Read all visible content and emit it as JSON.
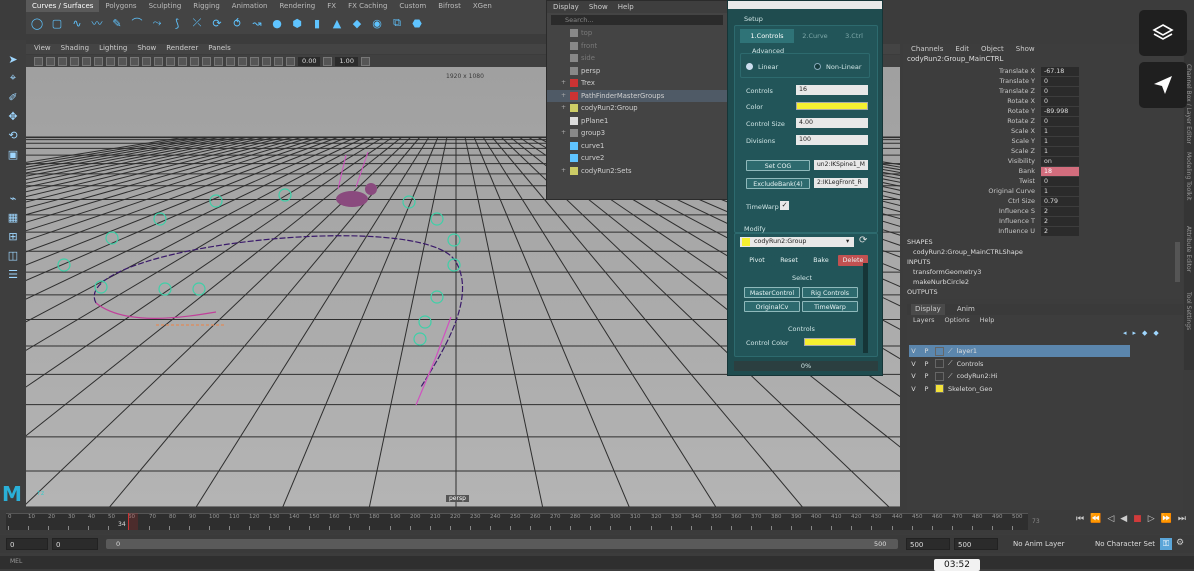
{
  "shelf": {
    "tabs": [
      "Curves / Surfaces",
      "Polygons",
      "Sculpting",
      "Rigging",
      "Animation",
      "Rendering",
      "FX",
      "FX Caching",
      "Custom",
      "Bifrost",
      "XGen"
    ]
  },
  "viewport": {
    "menu": [
      "View",
      "Shading",
      "Lighting",
      "Show",
      "Renderer",
      "Panels"
    ],
    "field1": "0.00",
    "field2": "1.00",
    "resolution": "1920 x 1080",
    "camera": "persp"
  },
  "outliner": {
    "menu": [
      "Display",
      "Show",
      "Help"
    ],
    "search_placeholder": "Search...",
    "items": [
      {
        "label": "top",
        "dim": true,
        "expand": ""
      },
      {
        "label": "front",
        "dim": true,
        "expand": ""
      },
      {
        "label": "side",
        "dim": true,
        "expand": ""
      },
      {
        "label": "persp",
        "dim": false,
        "expand": ""
      },
      {
        "label": "Trex",
        "dim": false,
        "expand": "+"
      },
      {
        "label": "PathFinderMasterGroups",
        "dim": false,
        "expand": "+",
        "selected": true
      },
      {
        "label": "codyRun2:Group",
        "dim": false,
        "expand": "+"
      },
      {
        "label": "pPlane1",
        "dim": false,
        "expand": ""
      },
      {
        "label": "group3",
        "dim": false,
        "expand": "+"
      },
      {
        "label": "curve1",
        "dim": false,
        "expand": ""
      },
      {
        "label": "curve2",
        "dim": false,
        "expand": ""
      },
      {
        "label": "codyRun2:Sets",
        "dim": false,
        "expand": "+"
      }
    ]
  },
  "rig_tool": {
    "setup_label": "Setup",
    "tabs": [
      "1.Controls",
      "2.Curve",
      "3.Ctrl"
    ],
    "advanced_label": "Advanced",
    "radio_linear": "Linear",
    "radio_nonlinear": "Non-Linear",
    "controls_label": "Controls",
    "controls_value": "16",
    "color_label": "Color",
    "control_size_label": "Control Size",
    "control_size_value": "4.00",
    "divisions_label": "Divisions",
    "divisions_value": "100",
    "set_cog_button": "Set COG",
    "set_cog_value": "un2:IKSpine1_M",
    "exclude_bank_button": "ExcludeBank(4)",
    "exclude_bank_value": "2:IKLegFront_R",
    "timewarp_label": "TimeWarp",
    "modify_label": "Modify",
    "group_select": "codyRun2:Group",
    "actions": [
      "Pivot",
      "Reset",
      "Bake",
      "Delete"
    ],
    "select_label": "Select",
    "select_buttons": [
      "MasterControl",
      "Rig Controls",
      "OriginalCv",
      "TimeWarp"
    ],
    "controls_section": "Controls",
    "control_color_label": "Control Color",
    "progress": "0%",
    "colors": {
      "yellow": "#f6f030",
      "panel": "#1f4c4f",
      "delete": "#c25151"
    }
  },
  "channel_box": {
    "menu": [
      "Channels",
      "Edit",
      "Object",
      "Show"
    ],
    "object": "codyRun2:Group_MainCTRL",
    "channels": [
      {
        "name": "Translate X",
        "value": "-67.18"
      },
      {
        "name": "Translate Y",
        "value": "0"
      },
      {
        "name": "Translate Z",
        "value": "0"
      },
      {
        "name": "Rotate X",
        "value": "0"
      },
      {
        "name": "Rotate Y",
        "value": "-89.998"
      },
      {
        "name": "Rotate Z",
        "value": "0"
      },
      {
        "name": "Scale X",
        "value": "1"
      },
      {
        "name": "Scale Y",
        "value": "1"
      },
      {
        "name": "Scale Z",
        "value": "1"
      },
      {
        "name": "Visibility",
        "value": "on"
      },
      {
        "name": "Bank",
        "value": "18",
        "highlight": true
      },
      {
        "name": "Twist",
        "value": "0"
      },
      {
        "name": "Original Curve",
        "value": "1"
      },
      {
        "name": "Ctrl Size",
        "value": "0.79"
      },
      {
        "name": "Influence S",
        "value": "2"
      },
      {
        "name": "Influence T",
        "value": "2"
      },
      {
        "name": "Influence U",
        "value": "2"
      }
    ],
    "shapes_label": "SHAPES",
    "shape_name": "codyRun2:Group_MainCTRLShape",
    "inputs_label": "INPUTS",
    "inputs": [
      "transformGeometry3",
      "makeNurbCircle2"
    ],
    "outputs_label": "OUTPUTS"
  },
  "layer_editor": {
    "tabs": [
      "Display",
      "Anim"
    ],
    "menu": [
      "Layers",
      "Options",
      "Help"
    ],
    "layers": [
      {
        "v": "V",
        "p": "P",
        "name": "layer1",
        "color": "",
        "selected": true
      },
      {
        "v": "V",
        "p": "P",
        "name": "Controls",
        "color": ""
      },
      {
        "v": "V",
        "p": "P",
        "name": "codyRun2:Hi",
        "color": ""
      },
      {
        "v": "V",
        "p": "P",
        "name": "Skeleton_Geo",
        "color": "#f3e23a"
      }
    ]
  },
  "side_tabs": [
    "Channel Box / Layer Editor",
    "Modeling Toolkit",
    "Attribute Editor",
    "Tool Settings"
  ],
  "timeline": {
    "ticks": [
      "0",
      "10",
      "20",
      "30",
      "40",
      "50",
      "60",
      "70",
      "80",
      "90",
      "100",
      "110",
      "120",
      "130",
      "140",
      "150",
      "160",
      "170",
      "180",
      "190",
      "200",
      "210",
      "220",
      "230",
      "240",
      "250",
      "260",
      "270",
      "280",
      "290",
      "300",
      "310",
      "320",
      "330",
      "340",
      "350",
      "360",
      "370",
      "380",
      "390",
      "400",
      "410",
      "420",
      "430",
      "440",
      "450",
      "460",
      "470",
      "480",
      "490",
      "500"
    ],
    "current_frame": "34",
    "end_label": "73"
  },
  "range": {
    "start": "0",
    "start_inner": "0",
    "slider_start": "0",
    "slider_end": "500",
    "end_inner": "500",
    "end": "500",
    "anim_layer": "No Anim Layer",
    "char_set": "No Character Set"
  },
  "status": {
    "mel": "MEL",
    "time": "03:52"
  }
}
